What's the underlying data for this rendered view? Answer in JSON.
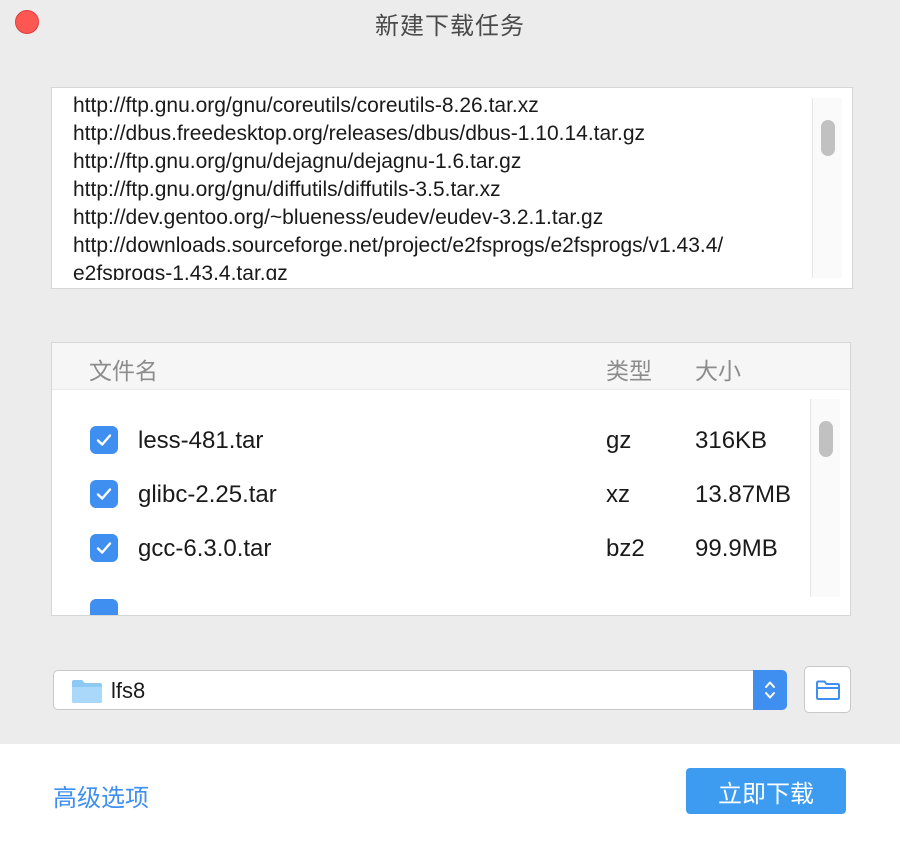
{
  "window": {
    "title": "新建下载任务"
  },
  "urls": {
    "lines": [
      "http://ftp.gnu.org/gnu/coreutils/coreutils-8.26.tar.xz",
      "http://dbus.freedesktop.org/releases/dbus/dbus-1.10.14.tar.gz",
      "http://ftp.gnu.org/gnu/dejagnu/dejagnu-1.6.tar.gz",
      "http://ftp.gnu.org/gnu/diffutils/diffutils-3.5.tar.xz",
      "http://dev.gentoo.org/~blueness/eudev/eudev-3.2.1.tar.gz",
      "http://downloads.sourceforge.net/project/e2fsprogs/e2fsprogs/v1.43.4/",
      "e2fsprogs-1.43.4.tar.gz"
    ]
  },
  "file_list": {
    "headers": {
      "name": "文件名",
      "type": "类型",
      "size": "大小"
    },
    "rows": [
      {
        "name": "less-481.tar",
        "type": "gz",
        "size": "316KB",
        "checked": true
      },
      {
        "name": "glibc-2.25.tar",
        "type": "xz",
        "size": "13.87MB",
        "checked": true
      },
      {
        "name": "gcc-6.3.0.tar",
        "type": "bz2",
        "size": "99.9MB",
        "checked": true
      }
    ]
  },
  "folder": {
    "selected": "lfs8"
  },
  "footer": {
    "advanced_label": "高级选项",
    "download_label": "立即下载"
  },
  "colors": {
    "accent": "#3f8ff0",
    "close": "#fc5753",
    "button": "#3d9cf0"
  }
}
